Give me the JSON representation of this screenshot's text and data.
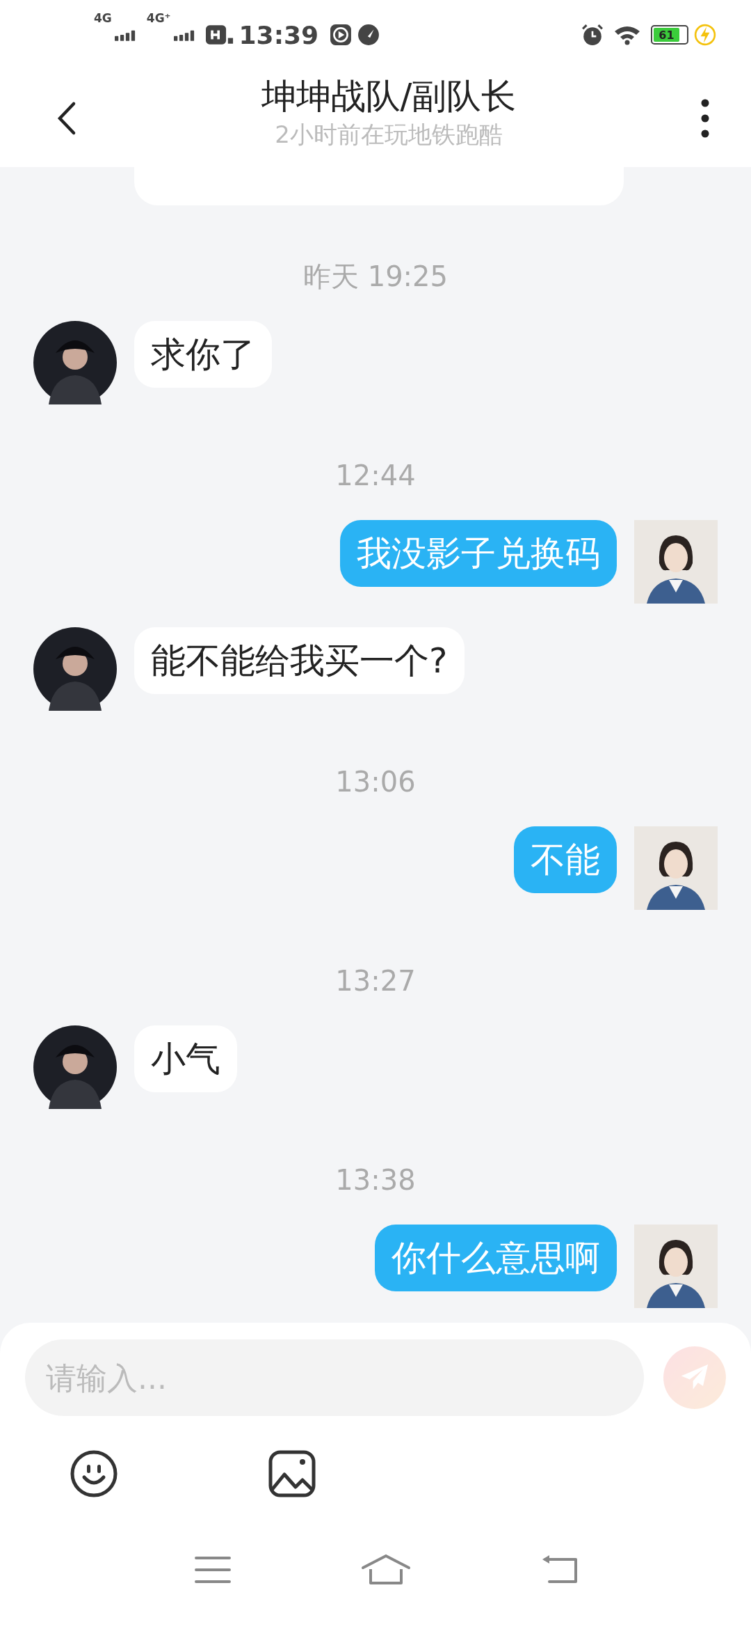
{
  "status_bar": {
    "time": "13:39",
    "network_1": "4G",
    "network_2": "4G⁺",
    "battery": "61"
  },
  "header": {
    "title": "坤坤战队/副队长",
    "subtitle": "2小时前在玩地铁跑酷"
  },
  "messages": [
    {
      "kind": "partial",
      "outgoing": false
    },
    {
      "kind": "time",
      "text": "昨天 19:25"
    },
    {
      "kind": "message",
      "outgoing": false,
      "text": "求你了"
    },
    {
      "kind": "time",
      "text": "12:44"
    },
    {
      "kind": "message",
      "outgoing": true,
      "text": "我没影子兑换码"
    },
    {
      "kind": "message",
      "outgoing": false,
      "text": "能不能给我买一个?"
    },
    {
      "kind": "time",
      "text": "13:06"
    },
    {
      "kind": "message",
      "outgoing": true,
      "text": "不能"
    },
    {
      "kind": "time",
      "text": "13:27"
    },
    {
      "kind": "message",
      "outgoing": false,
      "text": "小气"
    },
    {
      "kind": "time",
      "text": "13:38"
    },
    {
      "kind": "message",
      "outgoing": true,
      "text": "你什么意思啊"
    }
  ],
  "composer": {
    "placeholder": "请输入...",
    "send_disabled": true
  }
}
